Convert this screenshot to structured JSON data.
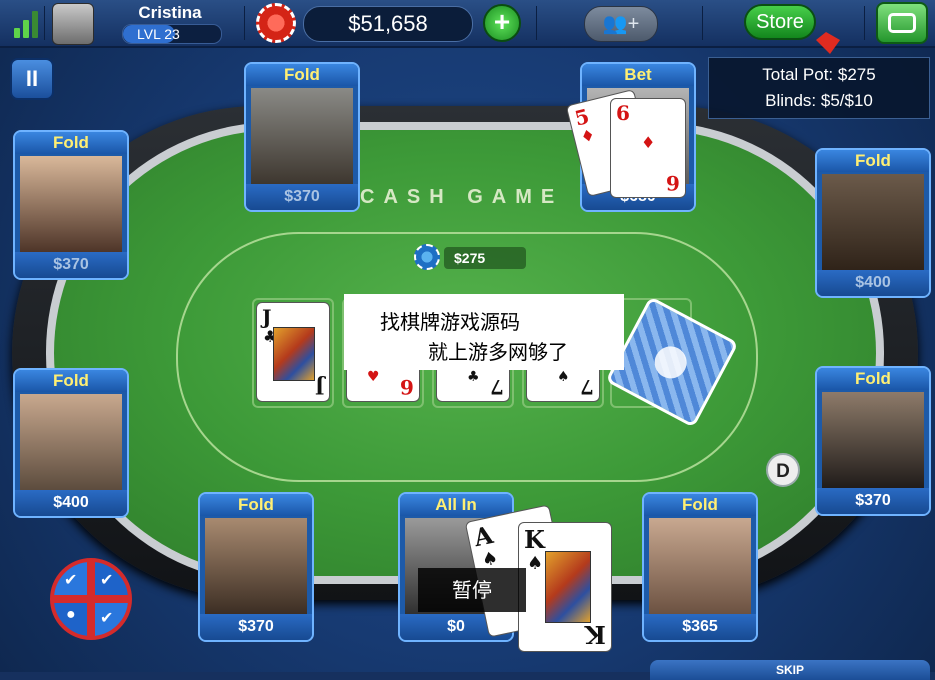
{
  "topbar": {
    "player_name": "Cristina",
    "level": "LVL 23",
    "balance": "$51,658",
    "add_chips_label": "+",
    "friends_label": "👥+",
    "store_label": "Store"
  },
  "pause_button_label": "II",
  "pot_box": {
    "total_pot": "Total Pot: $275",
    "blinds": "Blinds: $5/$10"
  },
  "table": {
    "title": "CASH GAME",
    "pot_amount": "$275",
    "dealer_label": "D"
  },
  "board_cards": [
    {
      "rank": "J",
      "suit": "♣",
      "color": "#111111"
    },
    {
      "rank": "6",
      "suit": "♥",
      "color": "#d41414"
    },
    {
      "rank": "7",
      "suit": "♣",
      "color": "#111111"
    },
    {
      "rank": "7",
      "suit": "♠",
      "color": "#111111"
    }
  ],
  "overlay_text": {
    "line1": "找棋牌游戏源码",
    "line2": "就上游多网够了"
  },
  "pause_overlay": "暂停",
  "seats": [
    {
      "status": "Fold",
      "amount": "$370"
    },
    {
      "status": "Bet",
      "amount": "$680"
    },
    {
      "status": "Fold",
      "amount": "$370"
    },
    {
      "status": "Fold",
      "amount": "$400"
    },
    {
      "status": "Fold",
      "amount": "$400"
    },
    {
      "status": "Fold",
      "amount": "$370"
    },
    {
      "status": "Fold",
      "amount": "$370"
    },
    {
      "status": "All In",
      "amount": "$0"
    },
    {
      "status": "Fold",
      "amount": "$365"
    }
  ],
  "bet_cards": [
    {
      "rank": "5",
      "suit": "♦"
    },
    {
      "rank": "6",
      "suit": "♦"
    }
  ],
  "hero_cards": [
    {
      "rank": "A",
      "suit": "♠"
    },
    {
      "rank": "K",
      "suit": "♠"
    }
  ],
  "skip_label": "SKIP",
  "colors": {
    "accent_blue": "#1d5aa8",
    "felt_green": "#3d9a38",
    "status_yellow": "#ffef73",
    "store_green": "#1a8c21"
  }
}
